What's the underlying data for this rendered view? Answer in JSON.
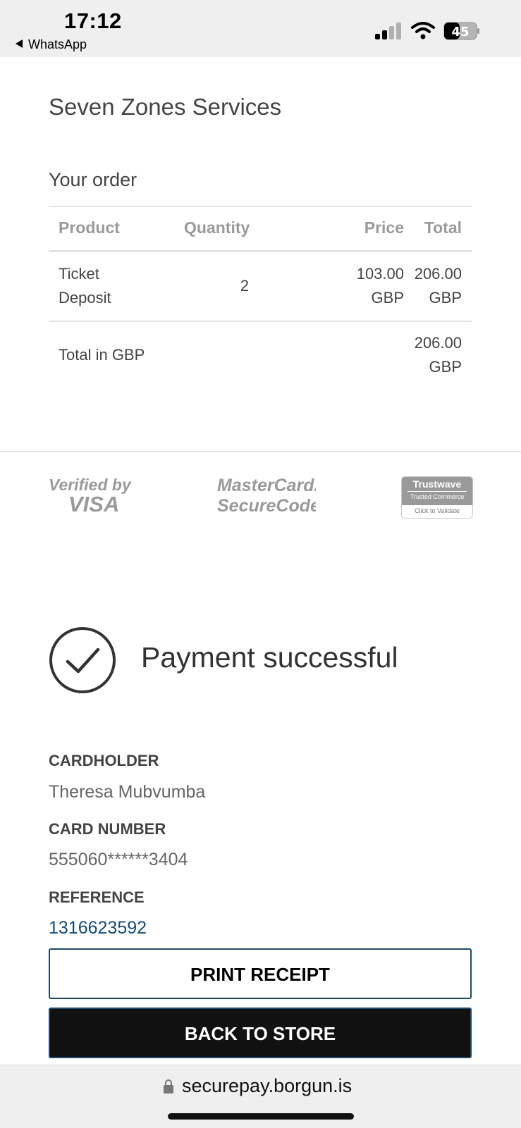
{
  "status_bar": {
    "time": "17:12",
    "back_app": "WhatsApp",
    "battery": "45"
  },
  "store": {
    "name": "Seven Zones Services"
  },
  "order": {
    "title": "Your order",
    "columns": [
      "Product",
      "Quantity",
      "Price",
      "Total"
    ],
    "rows": [
      {
        "product_line1": "Ticket",
        "product_line2": "Deposit",
        "quantity": "2",
        "price_line1": "103.00",
        "price_line2": "GBP",
        "total_line1": "206.00",
        "total_line2": "GBP"
      }
    ],
    "total_label": "Total in GBP",
    "total_value_line1": "206.00",
    "total_value_line2": "GBP"
  },
  "badges": {
    "visa_line1": "Verified by",
    "visa_line2": "VISA",
    "mastercard_line1": "MasterCard.",
    "mastercard_line2": "SecureCode.",
    "trustwave_name": "Trustwave",
    "trustwave_sub": "Trusted Commerce",
    "trustwave_cta": "Click to Validate"
  },
  "result": {
    "message": "Payment successful"
  },
  "details": {
    "cardholder_label": "CARDHOLDER",
    "cardholder_value": "Theresa Mubvumba",
    "card_number_label": "CARD NUMBER",
    "card_number_value": "555060******3404",
    "reference_label": "REFERENCE",
    "reference_value": "1316623592"
  },
  "buttons": {
    "print": "PRINT RECEIPT",
    "back": "BACK TO STORE"
  },
  "browser": {
    "url": "securepay.borgun.is"
  },
  "colors": {
    "link": "#154a7c",
    "button_border": "#1d4a6e",
    "primary_button": "#111111"
  }
}
